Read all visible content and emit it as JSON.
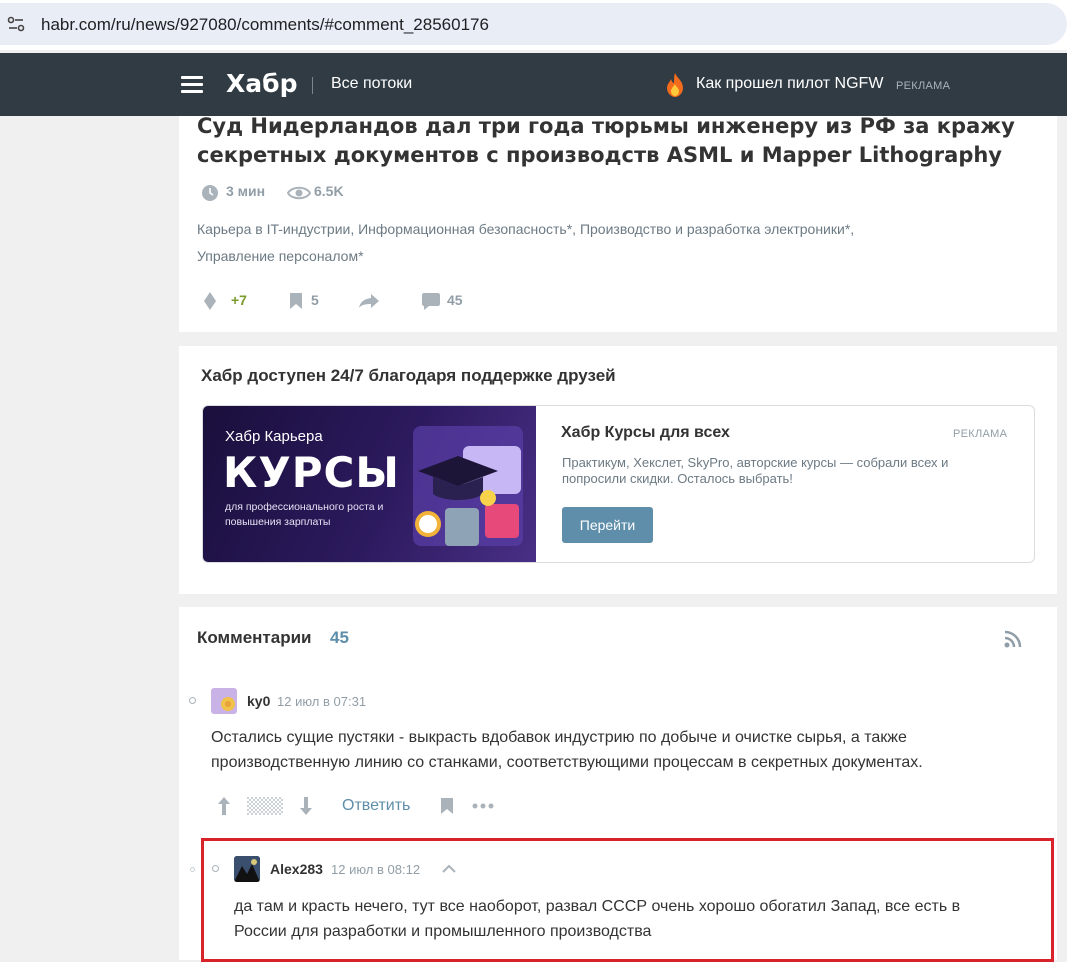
{
  "browser": {
    "url": "habr.com/ru/news/927080/comments/#comment_28560176"
  },
  "header": {
    "logo": "Хабр",
    "streams_label": "Все потоки",
    "promo_title": "Как прошел пилот NGFW",
    "promo_badge": "РЕКЛАМА"
  },
  "article": {
    "title": "Суд Нидерландов дал три года тюрьмы инженеру из РФ за кражу секретных документов с производств ASML и Mapper Lithography",
    "read_time": "3 мин",
    "views": "6.5K",
    "hubs_line1": "Карьера в IT-индустрии, Информационная безопасность*, Производство и разработка электроники*,",
    "hubs_line2": "Управление персоналом*",
    "rating": "+7",
    "bookmarks": "5",
    "comments": "45"
  },
  "support": {
    "title": "Хабр доступен 24/7 благодаря поддержке друзей",
    "banner_career": "Хабр Карьера",
    "banner_main": "КУРСЫ",
    "banner_sub": "для профессионального роста и повышения зарплаты",
    "ad_title": "Хабр Курсы для всех",
    "ad_badge": "РЕКЛАМА",
    "ad_desc": "Практикум, Хекслет, SkyPro, авторские курсы — собрали всех и попросили скидки. Осталось выбрать!",
    "ad_button": "Перейти"
  },
  "comments": {
    "title": "Комментарии",
    "count": "45",
    "items": [
      {
        "user": "ky0",
        "time": "12 июл в 07:31",
        "line1": "Остались сущие пустяки - выкрасть вдобавок индустрию по добыче и очистке сырья, а также",
        "line2": "производственную линию со станками, соответствующими процессам в секретных документах.",
        "reply_label": "Ответить"
      },
      {
        "user": "Alex283",
        "time": "12 июл в 08:12",
        "line1": "да там и красть нечего, тут все наоборот, развал СССР очень хорошо обогатил Запад, все есть в",
        "line2": "России для разработки и промышленного производства"
      }
    ]
  },
  "colors": {
    "topbar": "#303b44",
    "accent": "#5e8ea9",
    "rating_positive": "#7b9b2f",
    "highlight": "#d8232a"
  }
}
